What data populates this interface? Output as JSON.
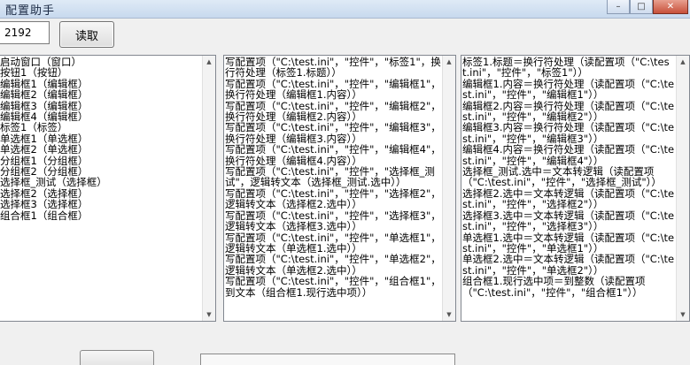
{
  "window": {
    "title": "配置助手",
    "caption_buttons": {
      "minimize": "–",
      "maximize": "□",
      "close": "✕"
    }
  },
  "toolbar": {
    "id_value": "2192",
    "read_button_label": "读取"
  },
  "left_pane": {
    "text": "启动窗口（窗口）\n按钮1（按钮）\n编辑框1（编辑框）\n编辑框2（编辑框）\n编辑框3（编辑框）\n编辑框4（编辑框）\n标签1（标签）\n单选框1（单选框）\n单选框2（单选框）\n分组框1（分组框）\n分组框2（分组框）\n选择框_测试（选择框）\n选择框2（选择框）\n选择框3（选择框）\n组合框1（组合框）"
  },
  "middle_pane": {
    "text": "写配置项（\"C:\\test.ini\"，\"控件\"，\"标签1\"，换行符处理（标签1.标题））\n写配置项（\"C:\\test.ini\"，\"控件\"，\"编辑框1\"，换行符处理（编辑框1.内容））\n写配置项（\"C:\\test.ini\"，\"控件\"，\"编辑框2\"，换行符处理（编辑框2.内容））\n写配置项（\"C:\\test.ini\"，\"控件\"，\"编辑框3\"，换行符处理（编辑框3.内容））\n写配置项（\"C:\\test.ini\"，\"控件\"，\"编辑框4\"，换行符处理（编辑框4.内容））\n写配置项（\"C:\\test.ini\"，\"控件\"，\"选择框_测试\"，逻辑转文本（选择框_测试.选中））\n写配置项（\"C:\\test.ini\"，\"控件\"，\"选择框2\"，逻辑转文本（选择框2.选中））\n写配置项（\"C:\\test.ini\"，\"控件\"，\"选择框3\"，逻辑转文本（选择框3.选中））\n写配置项（\"C:\\test.ini\"，\"控件\"，\"单选框1\"，逻辑转文本（单选框1.选中））\n写配置项（\"C:\\test.ini\"，\"控件\"，\"单选框2\"，逻辑转文本（单选框2.选中））\n写配置项（\"C:\\test.ini\"，\"控件\"，\"组合框1\"，到文本（组合框1.现行选中项））"
  },
  "right_pane": {
    "text": "标签1.标题＝换行符处理（读配置项（\"C:\\test.ini\"，\"控件\"，\"标签1\"））\n编辑框1.内容＝换行符处理（读配置项（\"C:\\test.ini\"，\"控件\"，\"编辑框1\"））\n编辑框2.内容＝换行符处理（读配置项（\"C:\\test.ini\"，\"控件\"，\"编辑框2\"））\n编辑框3.内容＝换行符处理（读配置项（\"C:\\test.ini\"，\"控件\"，\"编辑框3\"））\n编辑框4.内容＝换行符处理（读配置项（\"C:\\test.ini\"，\"控件\"，\"编辑框4\"））\n选择框_测试.选中＝文本转逻辑（读配置项（\"C:\\test.ini\"，\"控件\"，\"选择框_测试\"））\n选择框2.选中＝文本转逻辑（读配置项（\"C:\\test.ini\"，\"控件\"，\"选择框2\"））\n选择框3.选中＝文本转逻辑（读配置项（\"C:\\test.ini\"，\"控件\"，\"选择框3\"））\n单选框1.选中＝文本转逻辑（读配置项（\"C:\\test.ini\"，\"控件\"，\"单选框1\"））\n单选框2.选中＝文本转逻辑（读配置项（\"C:\\test.ini\"，\"控件\"，\"单选框2\"））\n组合框1.现行选中项＝到整数（读配置项（\"C:\\test.ini\"，\"控件\"，\"组合框1\"））"
  },
  "scroll_arrows": {
    "up": "▲",
    "down": "▼"
  }
}
